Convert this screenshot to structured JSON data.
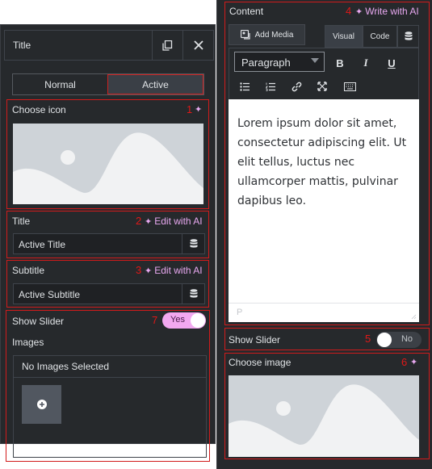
{
  "left": {
    "header_title": "Title",
    "tabs": [
      {
        "label": "Normal"
      },
      {
        "label": "Active"
      }
    ],
    "choose_icon": {
      "label": "Choose icon",
      "num": "1"
    },
    "title_field": {
      "label": "Title",
      "num": "2",
      "ai_label": "Edit with AI",
      "value": "Active Title"
    },
    "subtitle_field": {
      "label": "Subtitle",
      "num": "3",
      "ai_label": "Edit with AI",
      "value": "Active Subtitle"
    },
    "slider": {
      "label": "Show Slider",
      "num": "7",
      "toggle_text": "Yes"
    },
    "images": {
      "label": "Images",
      "empty_text": "No Images Selected"
    }
  },
  "right": {
    "content": {
      "label": "Content",
      "num": "4",
      "ai_label": "Write with AI"
    },
    "add_media_label": "Add Media",
    "tabs": [
      {
        "label": "Visual"
      },
      {
        "label": "Code"
      }
    ],
    "format_select": "Paragraph",
    "body_text": "Lorem ipsum dolor sit amet, consectetur adipiscing elit. Ut elit tellus, luctus nec ullamcorper mattis, pulvinar dapibus leo.",
    "status_path": "P",
    "slider": {
      "label": "Show Slider",
      "num": "5",
      "toggle_text": "No"
    },
    "choose_image": {
      "label": "Choose image",
      "num": "6"
    }
  },
  "colors": {
    "accent_red": "#d11b1b",
    "ai_pink": "#e8a8f0",
    "panel_bg": "#26292c"
  }
}
